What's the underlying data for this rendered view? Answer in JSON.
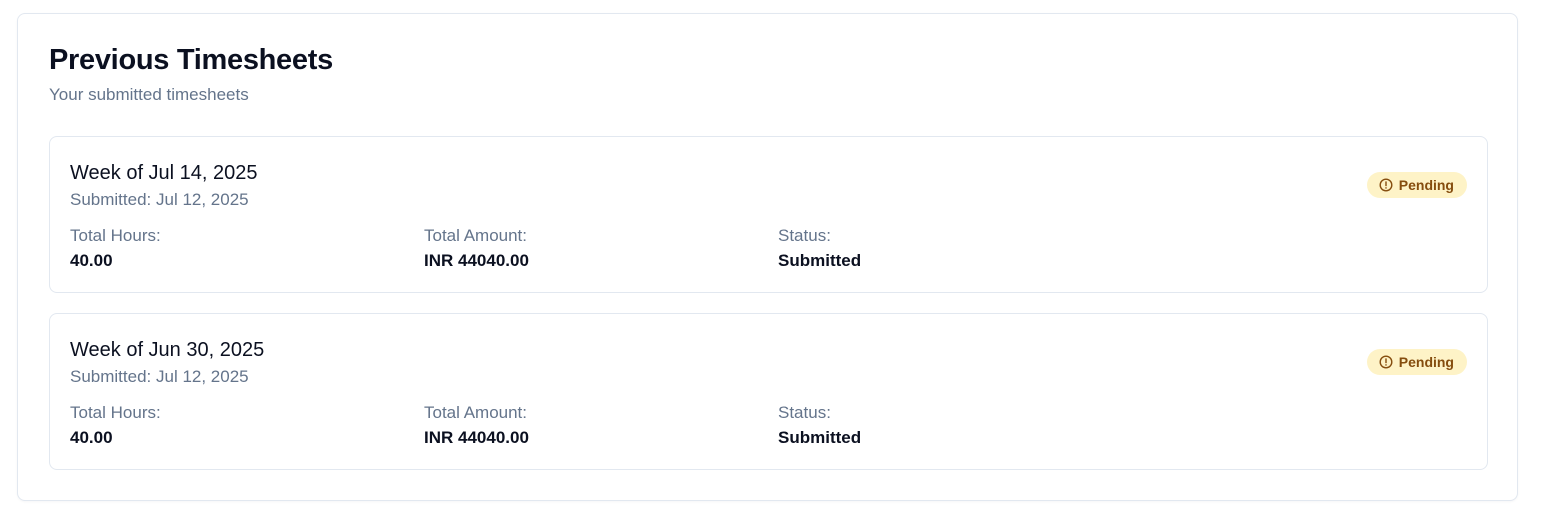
{
  "header": {
    "title": "Previous Timesheets",
    "subtitle": "Your submitted timesheets"
  },
  "timesheets": [
    {
      "week": "Week of Jul 14, 2025",
      "submitted": "Submitted: Jul 12, 2025",
      "status_badge": "Pending",
      "status_badge_icon": "alert-circle-icon",
      "hours_label": "Total Hours:",
      "hours_value": "40.00",
      "amount_label": "Total Amount:",
      "amount_value": "INR 44040.00",
      "status_label": "Status:",
      "status_value": "Submitted"
    },
    {
      "week": "Week of Jun 30, 2025",
      "submitted": "Submitted: Jul 12, 2025",
      "status_badge": "Pending",
      "status_badge_icon": "alert-circle-icon",
      "hours_label": "Total Hours:",
      "hours_value": "40.00",
      "amount_label": "Total Amount:",
      "amount_value": "INR 44040.00",
      "status_label": "Status:",
      "status_value": "Submitted"
    }
  ],
  "colors": {
    "badge_background": "#fef3c7",
    "badge_text": "#854d0e",
    "muted_text": "#64748b",
    "border": "#e2e8f0"
  }
}
